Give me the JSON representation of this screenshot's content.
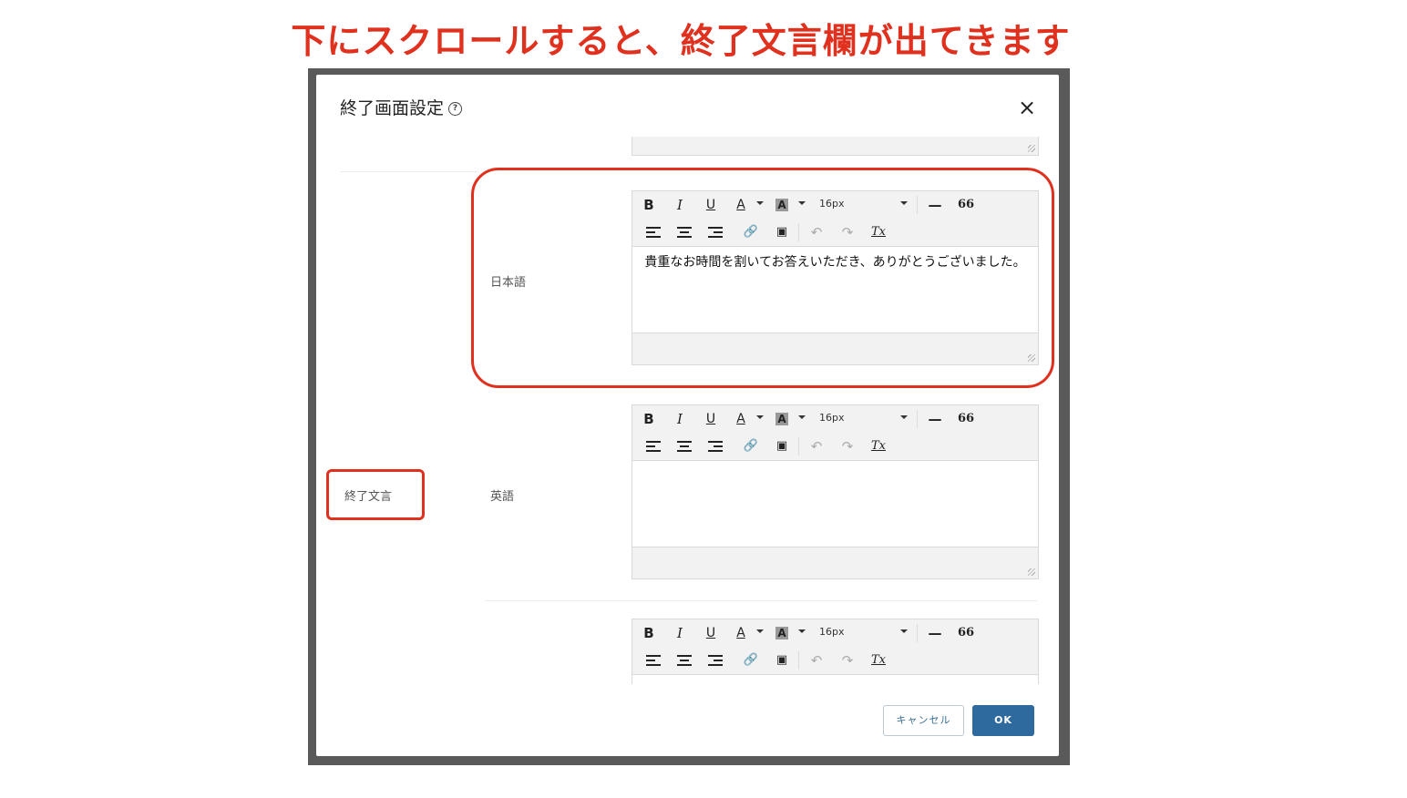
{
  "caption": "下にスクロールすると、終了文言欄が出てきます",
  "modal": {
    "title": "終了画面設定",
    "help_icon": "?",
    "close_icon": "×",
    "section_label": "終了文言",
    "fields": [
      {
        "label": "日本語",
        "content": "貴重なお時間を割いてお答えいただき、ありがとうございました。"
      },
      {
        "label": "英語",
        "content": ""
      },
      {
        "label": "",
        "content": ""
      }
    ],
    "toolbar": {
      "bold": "B",
      "italic": "I",
      "underline": "U",
      "font_color": "A",
      "bg_color": "A",
      "font_size": "16px",
      "hr": "—",
      "quote": "66",
      "clear_format": "Tx"
    },
    "buttons": {
      "cancel": "キャンセル",
      "ok": "OK"
    }
  },
  "colors": {
    "annotation": "#e0301e",
    "primary": "#2f6a9e"
  }
}
